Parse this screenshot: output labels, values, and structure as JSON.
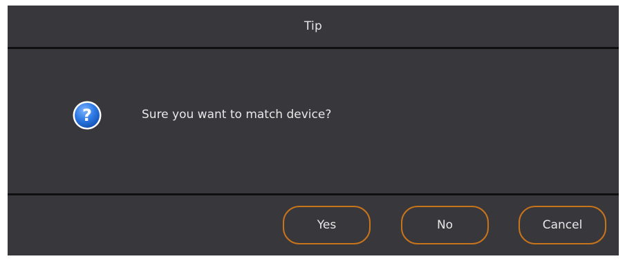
{
  "dialog": {
    "title": "Tip",
    "message": "Sure you want to match device?",
    "icon": "question-icon",
    "buttons": {
      "yes_label": "Yes",
      "no_label": "No",
      "cancel_label": "Cancel"
    }
  },
  "colors": {
    "dialog_background": "#38383c",
    "divider": "#0f0f0f",
    "button_border": "#c8741a",
    "icon_blue": "#2f7be6",
    "text": "#e8e8e8"
  }
}
